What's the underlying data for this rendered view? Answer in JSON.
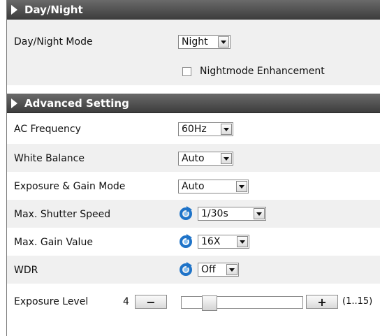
{
  "day_night": {
    "header": "Day/Night",
    "mode_label": "Day/Night Mode",
    "mode_value": "Night",
    "enhancement_label": "Nightmode Enhancement",
    "enhancement_checked": false
  },
  "advanced": {
    "header": "Advanced Setting",
    "ac_frequency": {
      "label": "AC Frequency",
      "value": "60Hz"
    },
    "white_balance": {
      "label": "White Balance",
      "value": "Auto"
    },
    "exposure_gain_mode": {
      "label": "Exposure & Gain Mode",
      "value": "Auto"
    },
    "max_shutter": {
      "label": "Max. Shutter Speed",
      "value": "1/30s"
    },
    "max_gain": {
      "label": "Max. Gain Value",
      "value": "16X"
    },
    "wdr": {
      "label": "WDR",
      "value": "Off"
    },
    "exposure_level": {
      "label": "Exposure Level",
      "value": "4",
      "minus": "−",
      "plus": "+",
      "range": "(1..15)",
      "min": 1,
      "max": 15
    }
  },
  "colors": {
    "header_bg": "#4a4a4a",
    "row_shade": "#f0f0f0",
    "icon_blue": "#1e73c8"
  },
  "icons": {
    "section_arrow": "triangle-right",
    "refresh": "refresh-icon"
  }
}
